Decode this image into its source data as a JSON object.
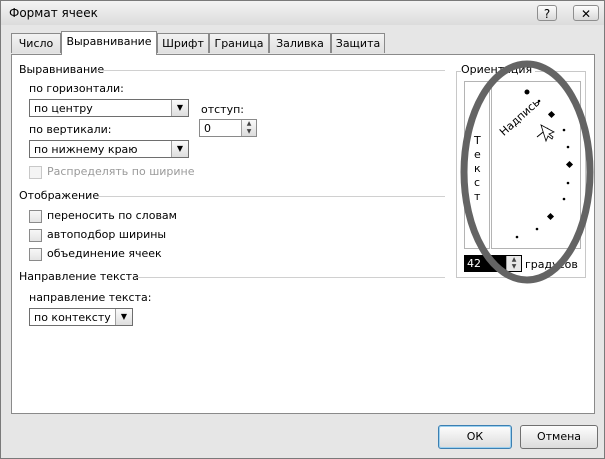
{
  "window": {
    "title": "Формат ячеек",
    "help_label": "?",
    "close_label": "✕"
  },
  "tabs": [
    {
      "label": "Число"
    },
    {
      "label": "Выравнивание",
      "active": true
    },
    {
      "label": "Шрифт"
    },
    {
      "label": "Граница"
    },
    {
      "label": "Заливка"
    },
    {
      "label": "Защита"
    }
  ],
  "alignment": {
    "section_title": "Выравнивание",
    "horizontal_label": "по горизонтали:",
    "horizontal_value": "по центру",
    "indent_label": "отступ:",
    "indent_value": "0",
    "vertical_label": "по вертикали:",
    "vertical_value": "по нижнему краю",
    "distribute_label": "Распределять по ширине"
  },
  "display": {
    "section_title": "Отображение",
    "wrap_label": "переносить по словам",
    "shrink_label": "автоподбор ширины",
    "merge_label": "объединение ячеек"
  },
  "direction": {
    "section_title": "Направление текста",
    "label": "направление текста:",
    "value": "по контексту"
  },
  "orientation": {
    "section_title": "Ориентация",
    "vertical_text": [
      "Т",
      "е",
      "к",
      "с",
      "т"
    ],
    "dial_text": "Надпись",
    "degrees_value": "42",
    "degrees_label": "градусов"
  },
  "buttons": {
    "ok_label": "ОК",
    "cancel_label": "Отмена"
  },
  "colors": {
    "highlight_ellipse": "#646464",
    "default_button_border": "#3c7fb1"
  }
}
